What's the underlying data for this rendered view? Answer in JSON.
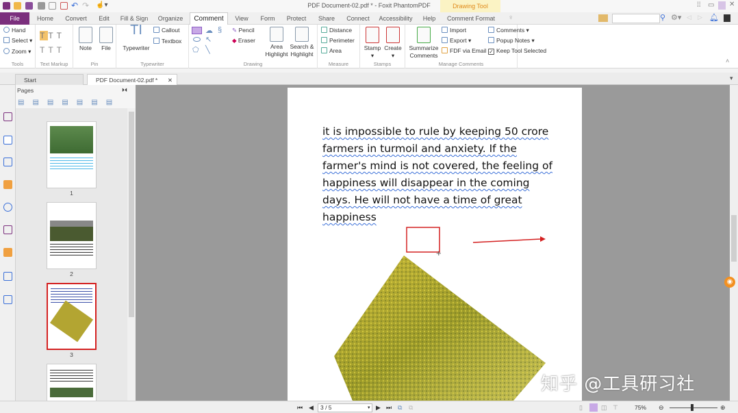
{
  "window": {
    "title": "PDF Document-02.pdf * - Foxit PhantomPDF",
    "context_tab": "Drawing Tool"
  },
  "tabs": [
    "File",
    "Home",
    "Convert",
    "Edit",
    "Fill & Sign",
    "Organize",
    "Comment",
    "View",
    "Form",
    "Protect",
    "Share",
    "Connect",
    "Accessibility",
    "Help",
    "Comment Format"
  ],
  "active_tab": "Comment",
  "ribbon": {
    "tools": {
      "label": "Tools",
      "items": [
        "Hand",
        "Select",
        "Zoom"
      ]
    },
    "text_markup": {
      "label": "Text Markup"
    },
    "pin": {
      "label": "Pin",
      "items": [
        "Note",
        "File"
      ]
    },
    "typewriter": {
      "label": "Typewriter",
      "items": [
        "Typewriter",
        "Callout",
        "Textbox"
      ]
    },
    "drawing": {
      "label": "Drawing",
      "items": [
        "Pencil",
        "Eraser"
      ],
      "area_highlight": "Area Highlight",
      "search_highlight": "Search & Highlight"
    },
    "measure": {
      "label": "Measure",
      "items": [
        "Distance",
        "Perimeter",
        "Area"
      ]
    },
    "stamps": {
      "label": "Stamps",
      "items": [
        "Stamp",
        "Create"
      ]
    },
    "manage": {
      "label": "Manage Comments",
      "summarize": "Summarize Comments",
      "items": [
        "Import",
        "Export",
        "FDF via Email",
        "Comments",
        "Popup Notes",
        "Keep Tool Selected"
      ],
      "keep_tool_selected": true
    }
  },
  "doc_tabs": [
    "Start",
    "PDF Document-02.pdf *"
  ],
  "pages_panel": {
    "title": "Pages",
    "thumb_labels": [
      "1",
      "2",
      "3"
    ]
  },
  "document": {
    "lines": [
      "it is impossible to rule by keeping 50 crore",
      "farmers in turmoil and anxiety. If the",
      "farmer's mind is not covered, the feeling of",
      "happiness will disappear in the coming",
      "days. He will not have a time of great",
      "happiness"
    ]
  },
  "status": {
    "page": "3 / 5",
    "zoom": "75%"
  },
  "watermark": "知乎 @工具研习社",
  "colors": {
    "file_tab": "#7b2f7d",
    "annotation": "#d42020",
    "underline": "#3a6fd8"
  }
}
